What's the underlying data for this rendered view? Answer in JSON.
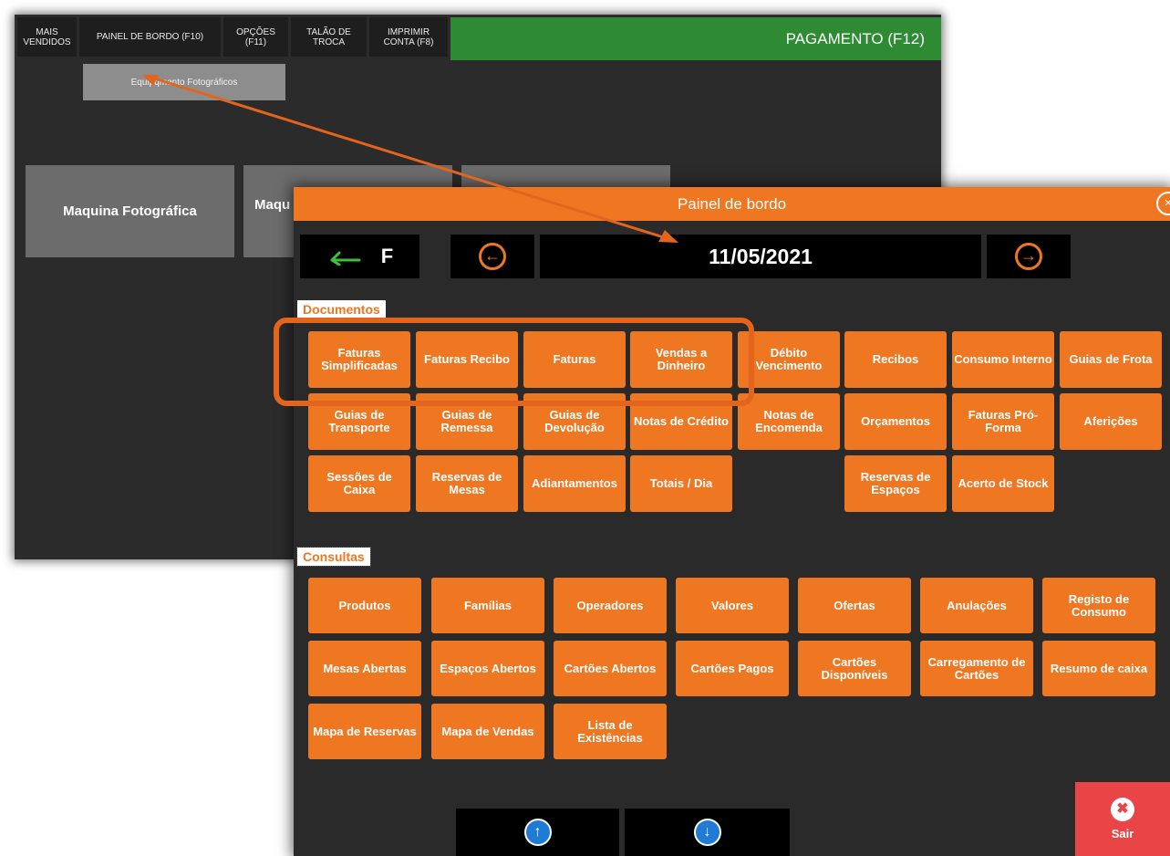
{
  "background_window": {
    "top_buttons": [
      {
        "label": "MAIS\nVENDIDOS"
      },
      {
        "label": "PAINEL DE BORDO (F10)"
      },
      {
        "label": "OPÇÕES\n(F11)"
      },
      {
        "label": "TALÃO DE\nTROCA"
      },
      {
        "label": "IMPRIMIR\nCONTA (F8)"
      }
    ],
    "payment_label": "PAGAMENTO (F12)",
    "category_button": "Equipqmento Fotográficos",
    "product_tiles": [
      {
        "label": "Maquina Fotográfica"
      },
      {
        "label": "Maqu"
      },
      {
        "label": ""
      }
    ]
  },
  "dialog": {
    "title": "Painel de bordo",
    "close_symbol": "×",
    "back_label": "F",
    "date": "11/05/2021",
    "sections": {
      "documentos": {
        "title": "Documentos",
        "buttons": [
          "Faturas Simplificadas",
          "Faturas Recibo",
          "Faturas",
          "Vendas a Dinheiro",
          "Débito Vencimento",
          "Recibos",
          "Consumo Interno",
          "Guias de Frota",
          "Guias de Transporte",
          "Guias de Remessa",
          "Guias de Devolução",
          "Notas de Crédito",
          "Notas de Encomenda",
          "Orçamentos",
          "Faturas Pró-Forma",
          "Aferições",
          "Sessões de Caixa",
          "Reservas de Mesas",
          "Adiantamentos",
          "Totais / Dia",
          "Reservas de Espaços",
          "Acerto de Stock"
        ]
      },
      "consultas": {
        "title": "Consultas",
        "buttons": [
          "Produtos",
          "Famílias",
          "Operadores",
          "Valores",
          "Ofertas",
          "Anulações",
          "Registo de Consumo",
          "Mesas Abertas",
          "Espaços Abertos",
          "Cartões Abertos",
          "Cartões Pagos",
          "Cartões Disponíveis",
          "Carregamento de Cartões",
          "Resumo de caixa",
          "Mapa de Reservas",
          "Mapa de Vendas",
          "Lista de Existências"
        ]
      }
    },
    "exit_label": "Sair"
  },
  "colors": {
    "accent_orange": "#ef7722",
    "payment_green": "#2e8b34",
    "exit_red": "#e94446",
    "scroll_blue": "#1f7bd6"
  },
  "icons": [
    "back-arrow-icon",
    "prev-arrow-icon",
    "next-arrow-icon",
    "close-icon",
    "scroll-up-icon",
    "scroll-down-icon",
    "exit-icon"
  ]
}
